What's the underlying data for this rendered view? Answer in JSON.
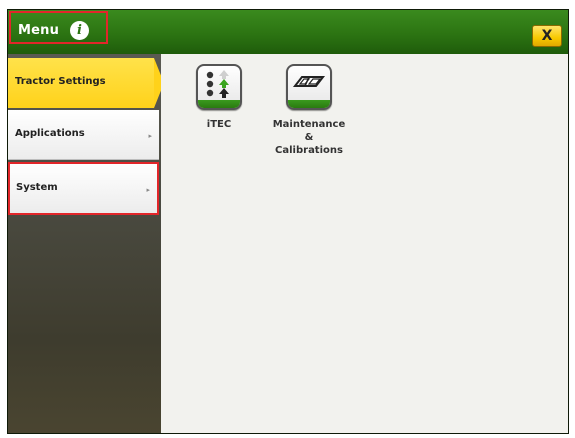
{
  "header": {
    "title": "Menu",
    "info_icon": "i",
    "close_label": "X"
  },
  "sidebar": {
    "items": [
      {
        "label": "Tractor Settings",
        "selected": true
      },
      {
        "label": "Applications",
        "arrow": "▸"
      },
      {
        "label": "System",
        "arrow": "▸"
      }
    ]
  },
  "content": {
    "apps": [
      {
        "label": "iTEC",
        "icon": "itec-sequence-icon"
      },
      {
        "label_lines": [
          "Maintenance",
          "&",
          "Calibrations"
        ],
        "icon": "maintenance-book-icon"
      }
    ]
  },
  "colors": {
    "header_green": "#2c7412",
    "selected_yellow": "#ffd21a",
    "highlight_red": "#e2262a",
    "close_yellow": "#f7c900"
  }
}
